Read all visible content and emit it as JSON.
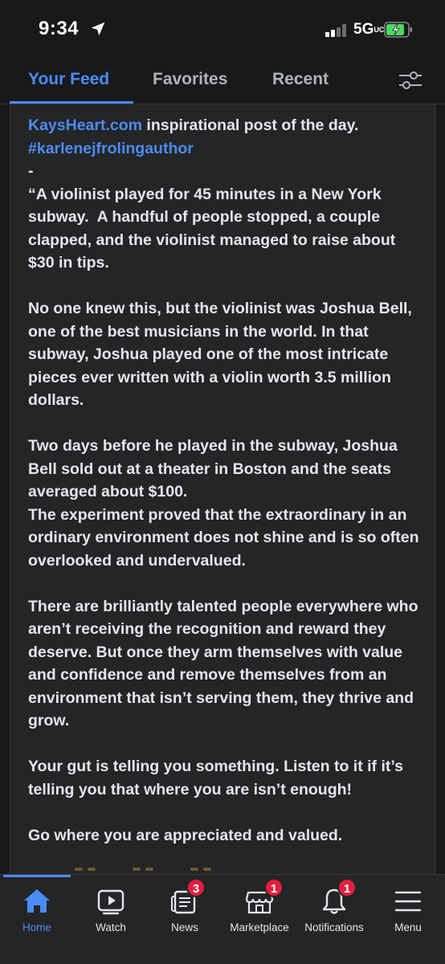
{
  "status_bar": {
    "time": "9:34",
    "network": "5G",
    "network_sub": "UC",
    "battery_state": "charging"
  },
  "feed_tabs": {
    "items": [
      {
        "label": "Your Feed",
        "active": true
      },
      {
        "label": "Favorites",
        "active": false
      },
      {
        "label": "Recent",
        "active": false
      }
    ]
  },
  "post": {
    "link_text": "KaysHeart.com",
    "intro_text": " inspirational post of the day.",
    "hashtag": "#karlenejfrolingauthor",
    "dash": "-",
    "para1": "“A violinist played for 45 minutes in a New York subway.  A handful of people stopped, a couple clapped, and the violinist managed to raise about $30 in tips.",
    "para2": "No one knew this, but the violinist was Joshua Bell, one of the best musicians in the world. In that subway, Joshua played one of the most intricate pieces ever written with a violin worth 3.5 million dollars.",
    "para3a": "Two days before he played in the subway, Joshua Bell sold out at a theater in Boston and the seats averaged about $100.",
    "para3b": "The experiment proved that the extraordinary in an ordinary environment does not shine and is so often overlooked and undervalued.",
    "para4": "There are brilliantly talented people everywhere who aren’t receiving the recognition and reward they deserve. But once they arm themselves with value and confidence and remove themselves from an environment that isn’t serving them, they thrive and grow.",
    "para5": "Your gut is telling you something. Listen to it if it’s telling you that where you are isn’t enough!",
    "para6": "Go where you are appreciated and valued."
  },
  "bottom_nav": {
    "items": [
      {
        "label": "Home",
        "icon": "home-icon",
        "active": true,
        "badge": ""
      },
      {
        "label": "Watch",
        "icon": "video-icon",
        "active": false,
        "badge": ""
      },
      {
        "label": "News",
        "icon": "news-icon",
        "active": false,
        "badge": "3"
      },
      {
        "label": "Marketplace",
        "icon": "marketplace-icon",
        "active": false,
        "badge": "1"
      },
      {
        "label": "Notifications",
        "icon": "bell-icon",
        "active": false,
        "badge": "1"
      },
      {
        "label": "Menu",
        "icon": "menu-icon",
        "active": false,
        "badge": ""
      }
    ]
  },
  "colors": {
    "accent": "#4c8bf5",
    "badge": "#e41e3f",
    "background": "#18191a",
    "card": "#242526"
  }
}
